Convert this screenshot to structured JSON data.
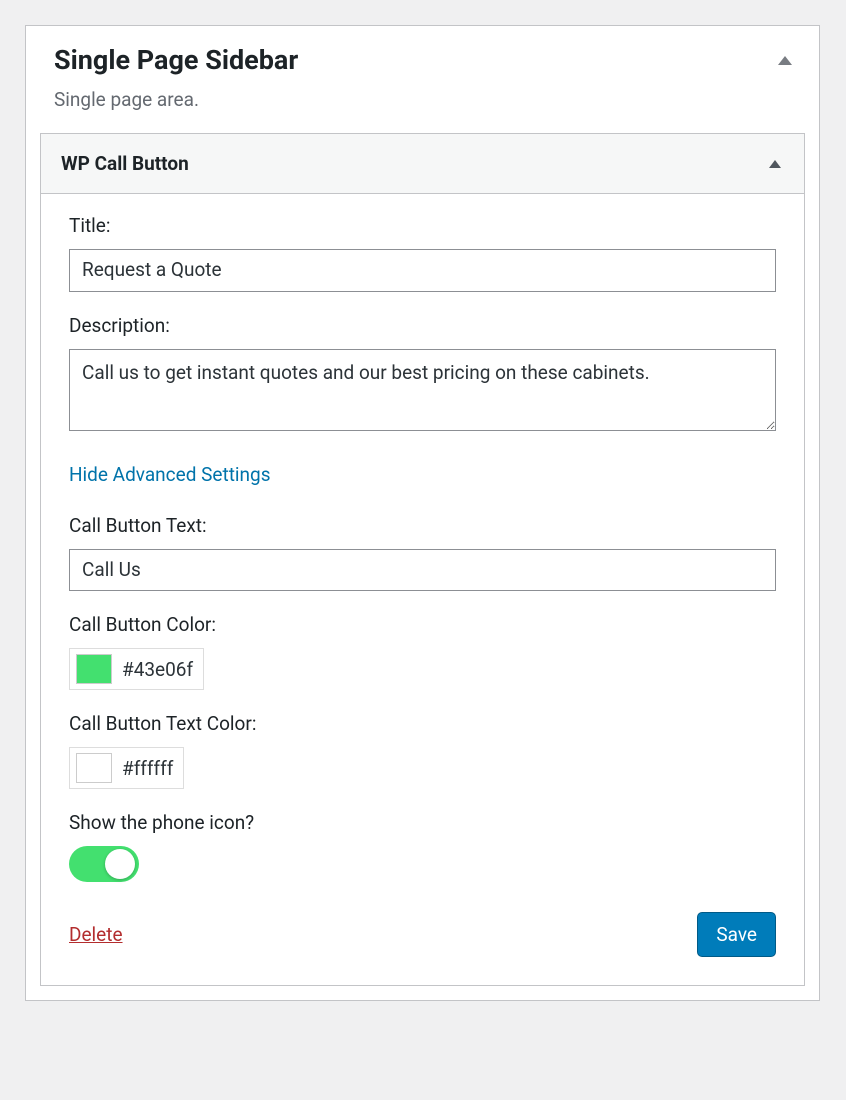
{
  "sidebar": {
    "title": "Single Page Sidebar",
    "description": "Single page area."
  },
  "widget": {
    "title": "WP Call Button",
    "fields": {
      "title_label": "Title:",
      "title_value": "Request a Quote",
      "description_label": "Description:",
      "description_value": "Call us to get instant quotes and our best pricing on these cabinets.",
      "advanced_toggle": "Hide Advanced Settings",
      "button_text_label": "Call Button Text:",
      "button_text_value": "Call Us",
      "button_color_label": "Call Button Color:",
      "button_color_value": "#43e06f",
      "button_text_color_label": "Call Button Text Color:",
      "button_text_color_value": "#ffffff",
      "show_icon_label": "Show the phone icon?",
      "show_icon_value": true
    },
    "actions": {
      "delete": "Delete",
      "save": "Save"
    }
  }
}
